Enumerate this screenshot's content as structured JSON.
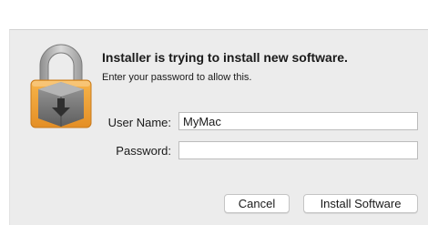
{
  "dialog": {
    "title": "Installer is trying to install new software.",
    "subtitle": "Enter your password to allow this.",
    "icon": "lock-icon"
  },
  "form": {
    "username_label": "User Name:",
    "username_value": "MyMac",
    "password_label": "Password:",
    "password_value": ""
  },
  "buttons": {
    "cancel_label": "Cancel",
    "install_label": "Install Software"
  },
  "colors": {
    "dialog_background": "#ececec",
    "lock_body": "#f2a33a",
    "lock_shackle": "#c2c2c2"
  }
}
